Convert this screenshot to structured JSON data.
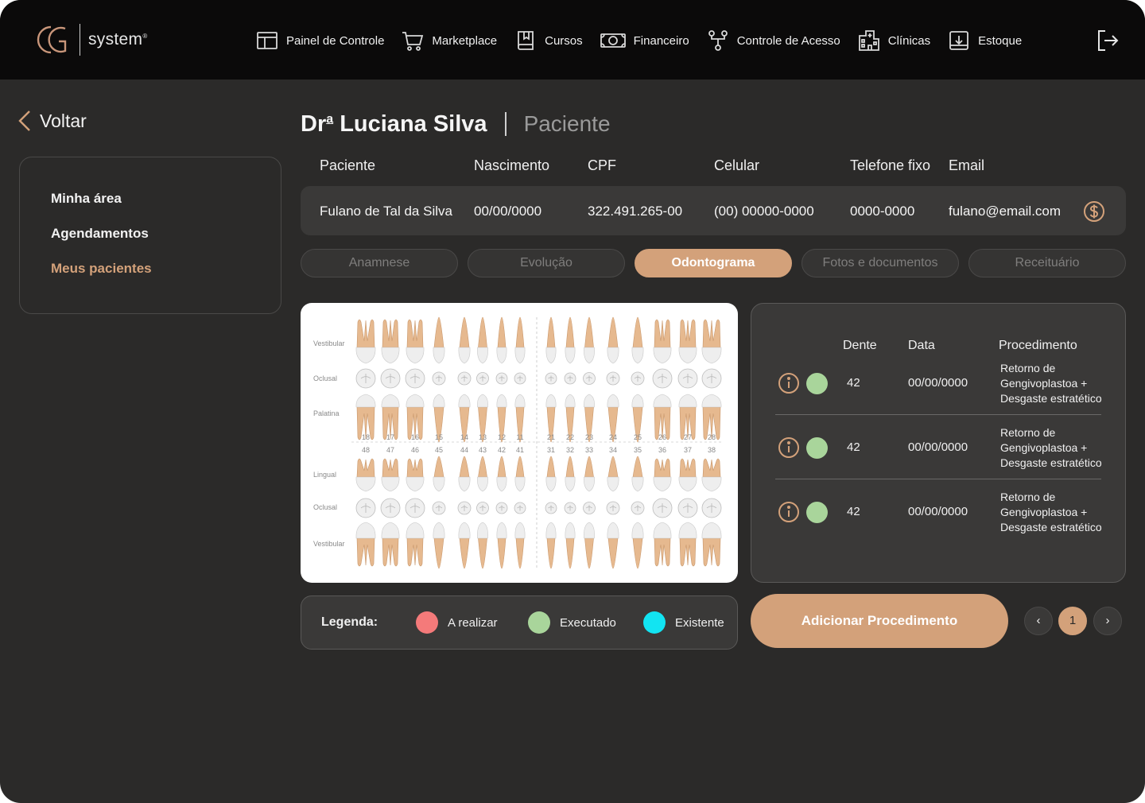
{
  "brand": {
    "mark": "GC",
    "text": "system",
    "reg": "®"
  },
  "nav": [
    {
      "label": "Painel de Controle",
      "icon": "layout-icon"
    },
    {
      "label": "Marketplace",
      "icon": "cart-icon"
    },
    {
      "label": "Cursos",
      "icon": "book-icon"
    },
    {
      "label": "Financeiro",
      "icon": "money-icon"
    },
    {
      "label": "Controle de Acesso",
      "icon": "network-icon"
    },
    {
      "label": "Clínicas",
      "icon": "building-icon"
    },
    {
      "label": "Estoque",
      "icon": "inbox-download-icon"
    }
  ],
  "back_label": "Voltar",
  "sidebar": [
    {
      "label": "Minha área",
      "active": false
    },
    {
      "label": "Agendamentos",
      "active": false
    },
    {
      "label": "Meus pacientes",
      "active": true
    }
  ],
  "header": {
    "name": "Dr",
    "name_sup": "a",
    "name_rest": " Luciana Silva",
    "role": "Paciente"
  },
  "patient": {
    "columns": [
      "Paciente",
      "Nascimento",
      "CPF",
      "Celular",
      "Telefone fixo",
      "Email"
    ],
    "values": [
      "Fulano de Tal da Silva",
      "00/00/0000",
      "322.491.265-00",
      "(00) 00000-0000",
      "0000-0000",
      "fulano@email.com"
    ]
  },
  "tabs": [
    {
      "label": "Anamnese",
      "active": false
    },
    {
      "label": "Evolução",
      "active": false
    },
    {
      "label": "Odontograma",
      "active": true
    },
    {
      "label": "Fotos e documentos",
      "active": false
    },
    {
      "label": "Receituário",
      "active": false
    }
  ],
  "odontogram": {
    "upper_rows": [
      "Vestibular",
      "Oclusal",
      "Palatina"
    ],
    "lower_rows": [
      "Lingual",
      "Oclusal",
      "Vestibular"
    ],
    "upper_numbers": [
      "18",
      "17",
      "16",
      "15",
      "14",
      "13",
      "12",
      "11",
      "21",
      "22",
      "23",
      "24",
      "25",
      "26",
      "27",
      "28"
    ],
    "lower_numbers": [
      "48",
      "47",
      "46",
      "45",
      "44",
      "43",
      "42",
      "41",
      "31",
      "32",
      "33",
      "34",
      "35",
      "36",
      "37",
      "38"
    ]
  },
  "procedures": {
    "headers": {
      "tooth": "Dente",
      "date": "Data",
      "procedure": "Procedimento"
    },
    "rows": [
      {
        "tooth": "42",
        "date": "00/00/0000",
        "procedure": "Retorno de Gengivoplastoa + Desgaste estratético",
        "status": "Executado"
      },
      {
        "tooth": "42",
        "date": "00/00/0000",
        "procedure": "Retorno de Gengivoplastoa + Desgaste estratético",
        "status": "Executado"
      },
      {
        "tooth": "42",
        "date": "00/00/0000",
        "procedure": "Retorno de Gengivoplastoa + Desgaste estratético",
        "status": "Executado"
      }
    ]
  },
  "legend": {
    "title": "Legenda:",
    "items": [
      {
        "label": "A realizar",
        "color": "#f47a7a"
      },
      {
        "label": "Executado",
        "color": "#a9d59b"
      },
      {
        "label": "Existente",
        "color": "#12e4f2"
      }
    ]
  },
  "add_button": "Adicionar Procedimento",
  "pagination": {
    "prev": "‹",
    "current": "1",
    "next": "›"
  },
  "colors": {
    "accent": "#d3a17a",
    "background": "#2b2a29",
    "topbar": "#0b0a0a",
    "panel": "#3a3938"
  }
}
